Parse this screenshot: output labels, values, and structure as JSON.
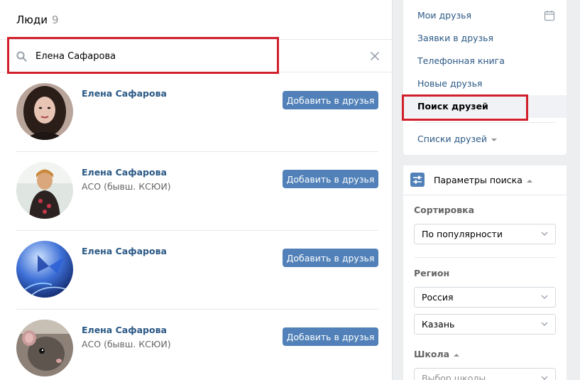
{
  "people": {
    "title": "Люди",
    "count": "9",
    "search": {
      "value": "Елена Сафарова"
    },
    "results": [
      {
        "name": "Елена Сафарова",
        "subtitle": "",
        "button": "Добавить в друзья"
      },
      {
        "name": "Елена Сафарова",
        "subtitle": "АСО (бывш. КСЮИ)",
        "button": "Добавить в друзья"
      },
      {
        "name": "Елена Сафарова",
        "subtitle": "",
        "button": "Добавить в друзья"
      },
      {
        "name": "Елена Сафарова",
        "subtitle": "АСО (бывш. КСЮИ)",
        "button": "Добавить в друзья"
      }
    ]
  },
  "nav": {
    "items": [
      {
        "label": "Мои друзья"
      },
      {
        "label": "Заявки в друзья"
      },
      {
        "label": "Телефонная книга"
      },
      {
        "label": "Новые друзья"
      },
      {
        "label": "Поиск друзей",
        "active": true
      }
    ],
    "lists_label": "Списки друзей"
  },
  "filters": {
    "title": "Параметры поиска",
    "sort": {
      "label": "Сортировка",
      "value": "По популярности"
    },
    "region": {
      "label": "Регион",
      "country": "Россия",
      "city": "Казань"
    },
    "school": {
      "label": "Школа",
      "placeholder": "Выбор школы"
    }
  },
  "colors": {
    "accent": "#5181b8",
    "link": "#2a5885",
    "highlight": "#d1202b",
    "background": "#edeef0"
  }
}
